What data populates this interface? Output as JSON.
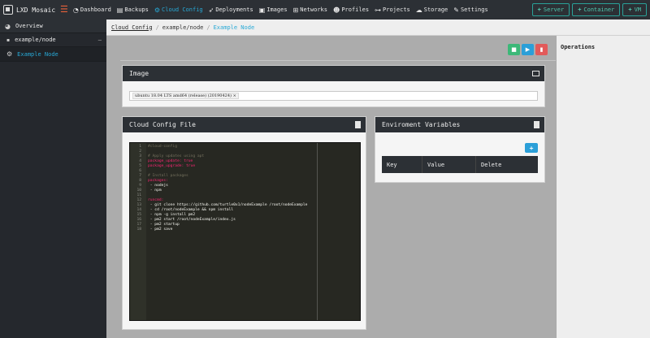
{
  "app": {
    "title": "LXD Mosaic"
  },
  "nav": {
    "items": [
      {
        "label": "Dashboard",
        "icon": "tachometer-icon"
      },
      {
        "label": "Backups",
        "icon": "backup-icon"
      },
      {
        "label": "Cloud Config",
        "icon": "gears-icon"
      },
      {
        "label": "Deployments",
        "icon": "rocket-icon"
      },
      {
        "label": "Images",
        "icon": "image-icon"
      },
      {
        "label": "Networks",
        "icon": "network-icon"
      },
      {
        "label": "Profiles",
        "icon": "users-icon"
      },
      {
        "label": "Projects",
        "icon": "project-diagram-icon"
      },
      {
        "label": "Storage",
        "icon": "database-icon"
      },
      {
        "label": "Settings",
        "icon": "wrench-icon"
      }
    ],
    "active": "Cloud Config",
    "actions": [
      {
        "label": "Server"
      },
      {
        "label": "Container"
      },
      {
        "label": "VM"
      }
    ]
  },
  "sidebar": {
    "overview": "Overview",
    "group": "example/node",
    "item": "Example Node"
  },
  "breadcrumb": {
    "root": "Cloud Config",
    "path": "example/node",
    "current": "Example Node"
  },
  "image_panel": {
    "title": "Image",
    "selected": "ubuntu 18.04 LTS amd64 (release) (20190424)",
    "remove": "×"
  },
  "cloud_config": {
    "title": "Cloud Config File",
    "lines": [
      {
        "n": "1",
        "t": "#cloud-config",
        "c": "tok-c"
      },
      {
        "n": "2",
        "t": "",
        "c": "tok-t"
      },
      {
        "n": "3",
        "t": "# Apply updates using apt",
        "c": "tok-c"
      },
      {
        "n": "4",
        "t": "package_update: true",
        "c": "tok-k"
      },
      {
        "n": "5",
        "t": "package_upgrade: true",
        "c": "tok-k"
      },
      {
        "n": "6",
        "t": "",
        "c": "tok-t"
      },
      {
        "n": "7",
        "t": "# Install packages",
        "c": "tok-c"
      },
      {
        "n": "8",
        "t": "packages:",
        "c": "tok-k"
      },
      {
        "n": "9",
        "t": " - nodejs",
        "c": "tok-t"
      },
      {
        "n": "10",
        "t": " - npm",
        "c": "tok-t"
      },
      {
        "n": "11",
        "t": "",
        "c": "tok-t"
      },
      {
        "n": "12",
        "t": "runcmd:",
        "c": "tok-k"
      },
      {
        "n": "13",
        "t": " - git clone https://github.com/turtle0x1/nodeExample /root/nodeExample",
        "c": "tok-t"
      },
      {
        "n": "14",
        "t": " - cd /root/nodeExample && npm install",
        "c": "tok-t"
      },
      {
        "n": "15",
        "t": " - npm -g install pm2",
        "c": "tok-t"
      },
      {
        "n": "16",
        "t": " - pm2 start /root/nodeExample/index.js",
        "c": "tok-t"
      },
      {
        "n": "17",
        "t": " - pm2 startup",
        "c": "tok-t"
      },
      {
        "n": "18",
        "t": " - pm2 save",
        "c": "tok-t"
      }
    ]
  },
  "env": {
    "title": "Enviroment Variables",
    "add": "+",
    "columns": [
      "Key",
      "Value",
      "Delete"
    ]
  },
  "operations": {
    "title": "Operations"
  }
}
